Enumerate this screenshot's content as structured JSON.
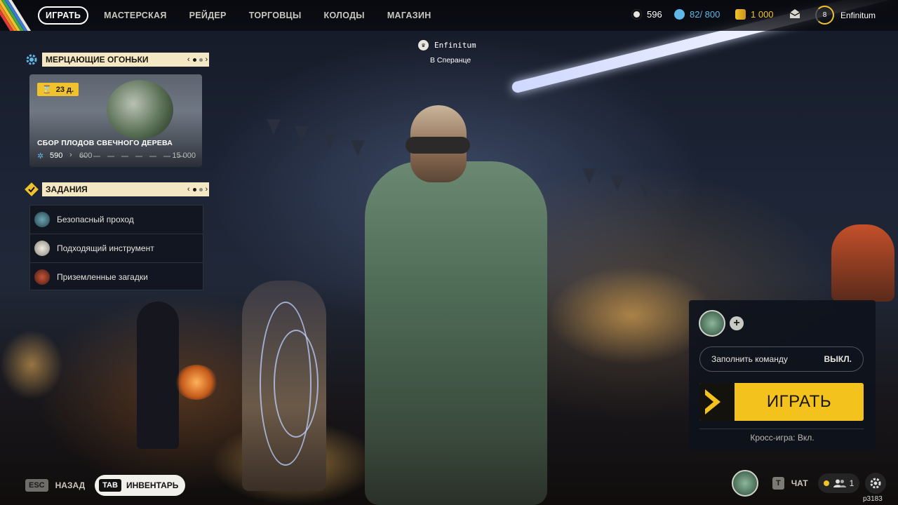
{
  "nav": {
    "items": [
      "ИГРАТЬ",
      "МАСТЕРСКАЯ",
      "РЕЙДЕР",
      "ТОРГОВЦЫ",
      "КОЛОДЫ",
      "МАГАЗИН"
    ],
    "active": "ИГРАТЬ"
  },
  "currencies": [
    {
      "icon": "coin-icon",
      "value": "596",
      "color": "#e8e6df"
    },
    {
      "icon": "credits-icon",
      "value": "82/ 800",
      "color": "#5fb8e8"
    },
    {
      "icon": "premium-currency-icon",
      "value": "1 000",
      "color": "#f0c22e"
    }
  ],
  "profile": {
    "level": "8",
    "name": "Enfinitum"
  },
  "event_panel": {
    "title": "МЕРЦАЮЩИЕ ОГОНЬКИ",
    "timer": "23 д.",
    "card_title": "СБОР ПЛОДОВ СВЕЧНОГО ДЕРЕВА",
    "progress_current": "590",
    "progress_mid": "600",
    "progress_max": "15 000"
  },
  "tasks_panel": {
    "title": "ЗАДАНИЯ",
    "items": [
      {
        "label": "Безопасный проход",
        "avatar_color": "#3d6a78"
      },
      {
        "label": "Подходящий инструмент",
        "avatar_color": "#d6d2c8"
      },
      {
        "label": "Приземленные загадки",
        "avatar_color": "#8a3a2a"
      }
    ]
  },
  "center": {
    "username": "Enfinitum",
    "location": "В Сперанце"
  },
  "play_panel": {
    "fill_team_label": "Заполнить команду",
    "fill_team_value": "ВЫКЛ.",
    "play_label": "ИГРАТЬ",
    "crossplay": "Кросс-игра: Вкл."
  },
  "bottom": {
    "back_key": "ESC",
    "back_label": "НАЗАД",
    "inventory_key": "TAB",
    "inventory_label": "ИНВЕНТАРЬ",
    "chat_key": "T",
    "chat_label": "ЧАТ",
    "friends_count": "1",
    "build": "p3183"
  },
  "colors": {
    "accent": "#f4c21d",
    "header_bg": "#f4e7c4",
    "panel_bg": "#0e121c"
  }
}
